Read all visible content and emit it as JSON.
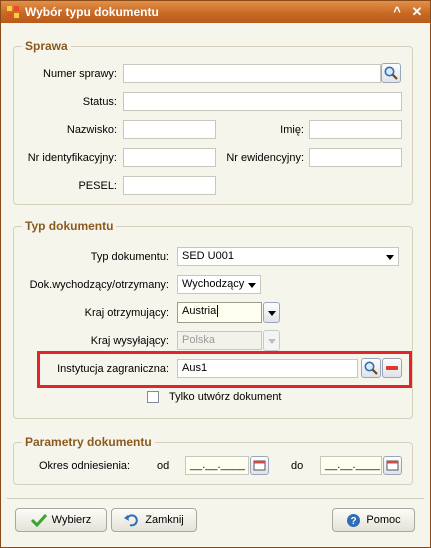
{
  "window": {
    "title": "Wybór typu dokumentu",
    "minimize": "^",
    "close": "✕"
  },
  "sprawa": {
    "legend": "Sprawa",
    "numer_label": "Numer sprawy:",
    "numer_value": "",
    "status_label": "Status:",
    "status_value": "",
    "nazwisko_label": "Nazwisko:",
    "nazwisko_value": "",
    "imie_label": "Imię:",
    "imie_value": "",
    "nr_id_label": "Nr identyfikacyjny:",
    "nr_id_value": "",
    "nr_ewid_label": "Nr ewidencyjny:",
    "nr_ewid_value": "",
    "pesel_label": "PESEL:",
    "pesel_value": ""
  },
  "typ": {
    "legend": "Typ dokumentu",
    "typ_label": "Typ dokumentu:",
    "typ_value": "SED U001",
    "dok_label": "Dok.wychodzący/otrzymany:",
    "dok_value": "Wychodzący",
    "kraj_otrz_label": "Kraj otrzymujący:",
    "kraj_otrz_value": "Austria",
    "kraj_wys_label": "Kraj wysyłający:",
    "kraj_wys_value": "Polska",
    "instytucja_label": "Instytucja zagraniczna:",
    "instytucja_value": "Aus1",
    "tylko_label": "Tylko utwórz dokument"
  },
  "parametry": {
    "legend": "Parametry dokumentu",
    "okres_label": "Okres odniesienia:",
    "od_label": "od",
    "od_value": "__.__.____",
    "do_label": "do",
    "do_value": "__.__.____"
  },
  "buttons": {
    "wybierz": "Wybierz",
    "zamknij": "Zamknij",
    "pomoc": "Pomoc"
  },
  "colors": {
    "titlebar": "#c86a24",
    "legend": "#8b5a1f",
    "highlight": "#e0262a",
    "focus_field": "#fffff0"
  }
}
